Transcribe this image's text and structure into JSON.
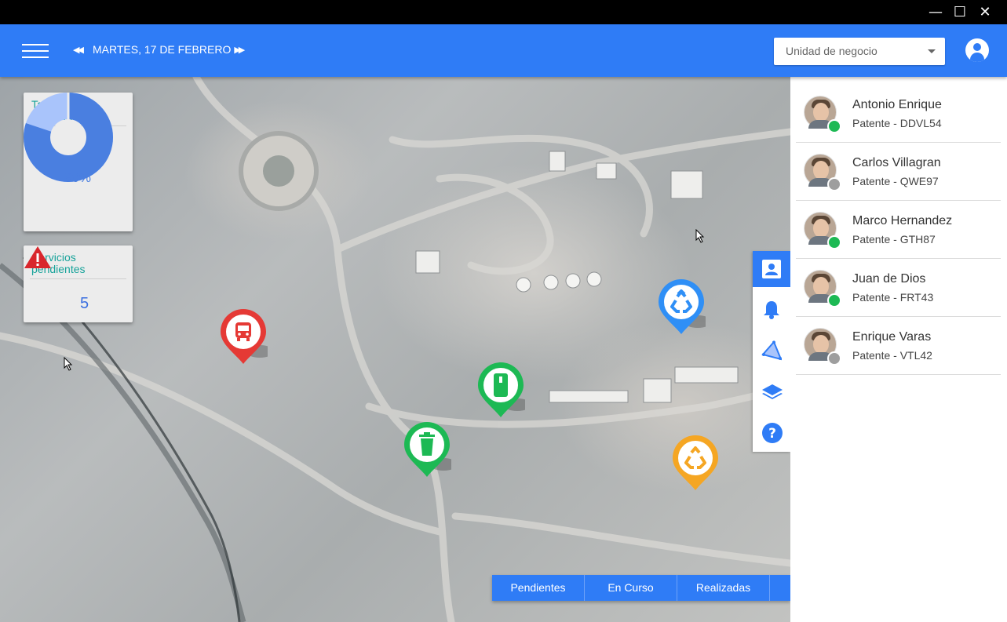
{
  "window": {
    "minimize_glyph": "—",
    "maximize_glyph": "☐",
    "close_glyph": "✕"
  },
  "header": {
    "menu_icon": "hamburger-menu-icon",
    "prev_glyph": "◀◀",
    "next_glyph": "▶▶",
    "date_label": "MARTES, 17 DE FEBRERO",
    "business_unit_placeholder": "Unidad de negocio",
    "account_icon": "account-circle-icon"
  },
  "kpis": {
    "compliance": {
      "title": "Tasa de cumplimiento",
      "value_label": "80%",
      "fraction": 0.8,
      "colors": {
        "filled": "#4a7fe0",
        "remaining": "#a9c4fb"
      }
    },
    "pending": {
      "title": "Servicios pendientes",
      "count": "5",
      "icon": "warning-triangle-icon"
    }
  },
  "map": {
    "markers": [
      {
        "name": "bus-marker",
        "icon": "bus-icon",
        "color": "#e53935"
      },
      {
        "name": "container-marker",
        "icon": "container-icon",
        "color": "#1db954"
      },
      {
        "name": "trash-marker",
        "icon": "trash-can-icon",
        "color": "#1db954"
      },
      {
        "name": "recycle-marker-blue",
        "icon": "recycle-icon",
        "color": "#2f8ff6"
      },
      {
        "name": "recycle-marker-orange",
        "icon": "recycle-icon",
        "color": "#f5a623"
      }
    ],
    "tools": [
      "driver-card-icon",
      "bell-icon",
      "polygon-area-icon",
      "layers-icon",
      "help-icon"
    ],
    "tabs": [
      "Pendientes",
      "En Curso",
      "Realizadas",
      ""
    ]
  },
  "drivers": [
    {
      "name": "Antonio Enrique",
      "plate": "Patente - DDVL54",
      "status": "online",
      "status_color": "#1db954"
    },
    {
      "name": "Carlos Villagran",
      "plate": "Patente - QWE97",
      "status": "offline",
      "status_color": "#9e9e9e"
    },
    {
      "name": "Marco Hernandez",
      "plate": "Patente - GTH87",
      "status": "online",
      "status_color": "#1db954"
    },
    {
      "name": "Juan de Dios",
      "plate": "Patente - FRT43",
      "status": "online",
      "status_color": "#1db954"
    },
    {
      "name": "Enrique Varas",
      "plate": "Patente - VTL42",
      "status": "offline",
      "status_color": "#9e9e9e"
    }
  ]
}
